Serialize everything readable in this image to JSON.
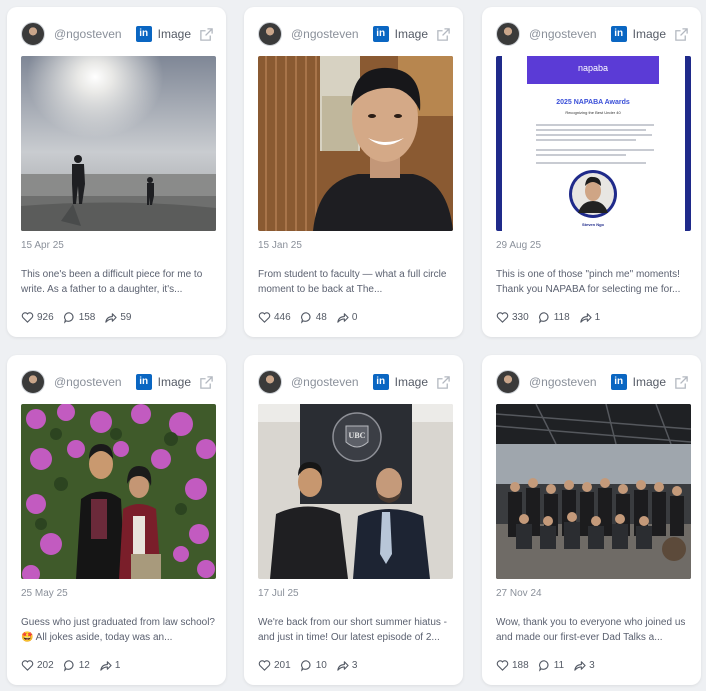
{
  "colors": {
    "background": "#eef0f3",
    "card": "#ffffff",
    "linkedin": "#0a66c2",
    "muted": "#8a909a"
  },
  "icons": {
    "likes": "heart-icon",
    "comments": "comment-icon",
    "shares": "share-icon",
    "open": "external-link-icon",
    "platform": "linkedin-icon"
  },
  "posts": [
    {
      "handle": "@ngosteven",
      "platform_label": "in",
      "type": "Image",
      "image": "silhouette-beach-photo",
      "date": "15 Apr 25",
      "caption": "This one's been a difficult piece for me to write. As a father to a daughter, it's...",
      "likes": "926",
      "comments": "158",
      "shares": "59"
    },
    {
      "handle": "@ngosteven",
      "platform_label": "in",
      "type": "Image",
      "image": "selfie-hallway-photo",
      "date": "15 Jan 25",
      "caption": "From student to faculty — what a full circle moment to be back at The...",
      "likes": "446",
      "comments": "48",
      "shares": "0"
    },
    {
      "handle": "@ngosteven",
      "platform_label": "in",
      "type": "Image",
      "image": "napaba-awards-email",
      "date": "29 Aug 25",
      "caption": "This is one of those \"pinch me\" moments! Thank you NAPABA for selecting me for...",
      "likes": "330",
      "comments": "118",
      "shares": "1",
      "image_text": {
        "logo": "napaba",
        "heading": "2025 NAPABA Awards",
        "subheading": "Recognizing the Best Under 40",
        "name": "Steven Ngo"
      }
    },
    {
      "handle": "@ngosteven",
      "platform_label": "in",
      "type": "Image",
      "image": "graduation-flowers-photo",
      "date": "25 May 25",
      "caption": "Guess who just graduated from law school? 🤩 All jokes aside, today was an...",
      "likes": "202",
      "comments": "12",
      "shares": "1"
    },
    {
      "handle": "@ngosteven",
      "platform_label": "in",
      "type": "Image",
      "image": "ubc-two-men-photo",
      "date": "17 Jul 25",
      "caption": "We're back from our short summer hiatus - and just in time! Our latest episode of 2...",
      "likes": "201",
      "comments": "10",
      "shares": "3",
      "image_text": {
        "seal": "UBC"
      }
    },
    {
      "handle": "@ngosteven",
      "platform_label": "in",
      "type": "Image",
      "image": "dad-talks-group-photo",
      "date": "27 Nov 24",
      "caption": "Wow, thank you to everyone who joined us and made our first-ever Dad Talks a...",
      "likes": "188",
      "comments": "11",
      "shares": "3"
    }
  ]
}
